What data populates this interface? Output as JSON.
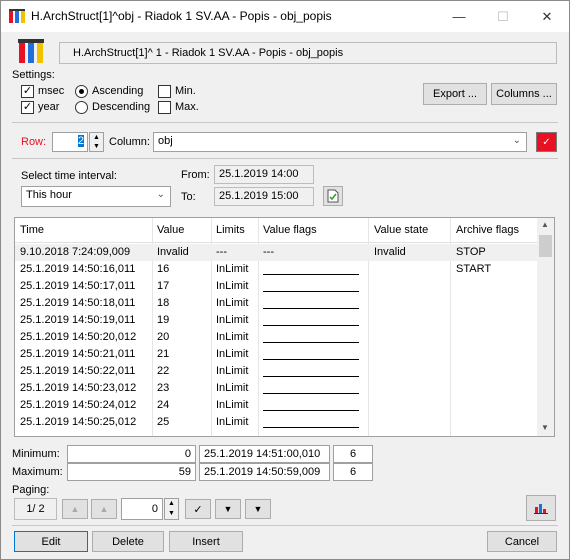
{
  "window": {
    "title": "H.ArchStruct[1]^obj - Riadok 1 SV.AA - Popis - obj_popis"
  },
  "header": {
    "object_name": "H.ArchStruct[1]^ 1 - Riadok 1 SV.AA - Popis  - obj_popis"
  },
  "settings": {
    "label": "Settings:",
    "msec_label": "msec",
    "msec_checked": true,
    "year_label": "year",
    "year_checked": true,
    "ascending_label": "Ascending",
    "descending_label": "Descending",
    "sort_selected": "Ascending",
    "min_label": "Min.",
    "min_checked": false,
    "max_label": "Max.",
    "max_checked": false,
    "export_label": "Export ...",
    "columns_label": "Columns ..."
  },
  "row_col": {
    "row_label": "Row:",
    "row_value": "2",
    "column_label": "Column:",
    "column_value": "obj",
    "color": "#e81123"
  },
  "interval": {
    "label": "Select time interval:",
    "value": "This hour",
    "from_label": "From:",
    "from_value": "25.1.2019 14:00",
    "to_label": "To:",
    "to_value": "25.1.2019 15:00"
  },
  "table": {
    "columns": [
      "Time",
      "Value",
      "Limits",
      "Value flags",
      "Value state",
      "Archive flags"
    ],
    "rows": [
      {
        "time": "9.10.2018 7:24:09,009",
        "value": "Invalid",
        "limits": "---",
        "flags": "---",
        "state": "Invalid",
        "archive": "STOP"
      },
      {
        "time": "25.1.2019 14:50:16,011",
        "value": "16",
        "limits": "InLimit",
        "flags": "",
        "state": "",
        "archive": "START"
      },
      {
        "time": "25.1.2019 14:50:17,011",
        "value": "17",
        "limits": "InLimit",
        "flags": "",
        "state": "",
        "archive": ""
      },
      {
        "time": "25.1.2019 14:50:18,011",
        "value": "18",
        "limits": "InLimit",
        "flags": "",
        "state": "",
        "archive": ""
      },
      {
        "time": "25.1.2019 14:50:19,011",
        "value": "19",
        "limits": "InLimit",
        "flags": "",
        "state": "",
        "archive": ""
      },
      {
        "time": "25.1.2019 14:50:20,012",
        "value": "20",
        "limits": "InLimit",
        "flags": "",
        "state": "",
        "archive": ""
      },
      {
        "time": "25.1.2019 14:50:21,011",
        "value": "21",
        "limits": "InLimit",
        "flags": "",
        "state": "",
        "archive": ""
      },
      {
        "time": "25.1.2019 14:50:22,011",
        "value": "22",
        "limits": "InLimit",
        "flags": "",
        "state": "",
        "archive": ""
      },
      {
        "time": "25.1.2019 14:50:23,012",
        "value": "23",
        "limits": "InLimit",
        "flags": "",
        "state": "",
        "archive": ""
      },
      {
        "time": "25.1.2019 14:50:24,012",
        "value": "24",
        "limits": "InLimit",
        "flags": "",
        "state": "",
        "archive": ""
      },
      {
        "time": "25.1.2019 14:50:25,012",
        "value": "25",
        "limits": "InLimit",
        "flags": "",
        "state": "",
        "archive": ""
      }
    ]
  },
  "stats": {
    "min_label": "Minimum:",
    "min_value": "0",
    "min_time": "25.1.2019 14:51:00,010",
    "min_count": "6",
    "max_label": "Maximum:",
    "max_value": "59",
    "max_time": "25.1.2019 14:50:59,009",
    "max_count": "6"
  },
  "paging": {
    "label": "Paging:",
    "page": "1/ 2",
    "step": "0"
  },
  "footer": {
    "edit_label": "Edit",
    "delete_label": "Delete",
    "insert_label": "Insert",
    "cancel_label": "Cancel"
  }
}
